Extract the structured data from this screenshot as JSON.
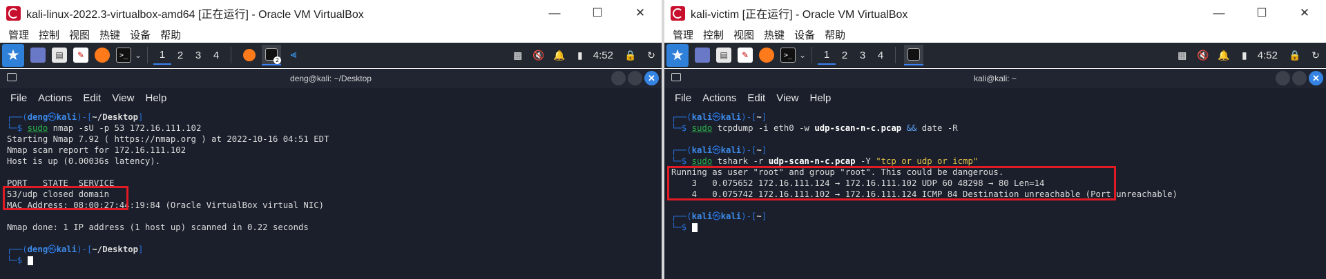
{
  "left": {
    "title": "kali-linux-2022.3-virtualbox-amd64 [正在运行] - Oracle VM VirtualBox",
    "menu": [
      "管理",
      "控制",
      "视图",
      "热键",
      "设备",
      "帮助"
    ],
    "workspaces": [
      "1",
      "2",
      "3",
      "4"
    ],
    "clock": "4:52",
    "task_badge": "2",
    "terminal": {
      "title": "deng@kali: ~/Desktop",
      "menu": [
        "File",
        "Actions",
        "Edit",
        "View",
        "Help"
      ],
      "prompt1": {
        "user": "deng",
        "host": "kali",
        "path": "~/Desktop"
      },
      "cmd1": {
        "sudo": "sudo",
        "prog": "nmap",
        "args": " -sU -p 53 172.16.111.102"
      },
      "output": [
        "Starting Nmap 7.92 ( https://nmap.org ) at 2022-10-16 04:51 EDT",
        "Nmap scan report for 172.16.111.102",
        "Host is up (0.00036s latency).",
        "",
        "PORT   STATE  SERVICE",
        "53/udp closed domain",
        "MAC Address: 08:00:27:44:19:84 (Oracle VirtualBox virtual NIC)",
        "",
        "Nmap done: 1 IP address (1 host up) scanned in 0.22 seconds",
        ""
      ],
      "prompt2": {
        "user": "deng",
        "host": "kali",
        "path": "~/Desktop"
      }
    }
  },
  "right": {
    "title": "kali-victim [正在运行] - Oracle VM VirtualBox",
    "menu": [
      "管理",
      "控制",
      "视图",
      "热键",
      "设备",
      "帮助"
    ],
    "workspaces": [
      "1",
      "2",
      "3",
      "4"
    ],
    "clock": "4:52",
    "terminal": {
      "title": "kali@kali: ~",
      "menu": [
        "File",
        "Actions",
        "Edit",
        "View",
        "Help"
      ],
      "prompt1": {
        "user": "kali",
        "host": "kali",
        "path": "~"
      },
      "cmd1": {
        "sudo": "sudo",
        "prog": "tcpdump",
        "a1": " -i eth0 -w ",
        "file": "udp-scan-n-c.pcap",
        "amp": " &&",
        "a2": " date -R"
      },
      "prompt2": {
        "user": "kali",
        "host": "kali",
        "path": "~"
      },
      "cmd2": {
        "sudo": "sudo",
        "prog": "tshark",
        "a1": " -r ",
        "file": "udp-scan-n-c.pcap",
        "a2": " -Y ",
        "filter": "\"tcp or udp or icmp\""
      },
      "output": [
        "Running as user \"root\" and group \"root\". This could be dangerous.",
        "    3   0.075652 172.16.111.124 → 172.16.111.102 UDP 60 48298 → 80 Len=14",
        "    4   0.075742 172.16.111.102 → 172.16.111.124 ICMP 84 Destination unreachable (Port unreachable)",
        ""
      ],
      "prompt3": {
        "user": "kali",
        "host": "kali",
        "path": "~"
      }
    }
  },
  "icons": {
    "minimize": "minimize-icon",
    "maximize": "maximize-icon",
    "close": "close-icon"
  },
  "colors": {
    "terminal_bg": "#1a1f2b",
    "prompt_blue": "#2b74e0",
    "command_green": "#2bb04a",
    "highlight_red": "#e01b24",
    "panel_bg": "#23272f"
  }
}
